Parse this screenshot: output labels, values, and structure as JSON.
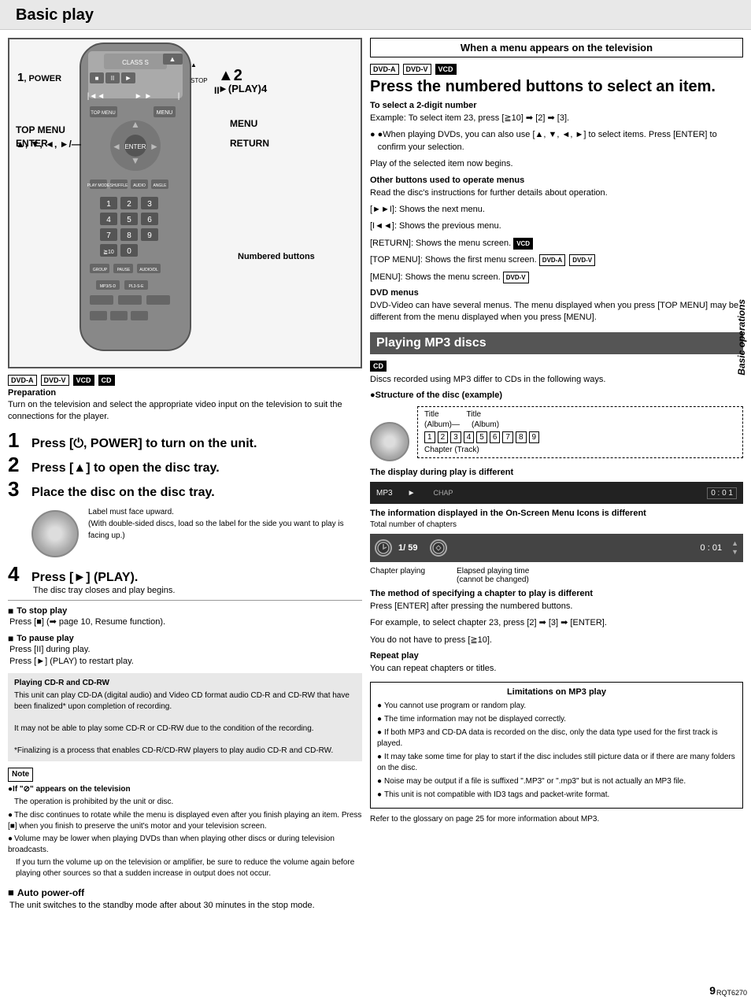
{
  "page": {
    "title": "Basic play",
    "page_number": "9",
    "rqt_code": "RQT6270",
    "side_label": "Basic operations"
  },
  "badges": {
    "dvd_a": "DVD-A",
    "dvd_v": "DVD-V",
    "vcd": "VCD",
    "cd": "CD"
  },
  "remote_labels": {
    "label1": "1",
    "power": ", POWER",
    "label2": "▲2",
    "play_4": "►(PLAY)4",
    "pause": "II",
    "arrows": "▲, ▼, ◄, ►/—",
    "top_menu": "TOP MENU",
    "menu": "MENU",
    "enter": "ENTER",
    "return": "RETURN",
    "numbered_buttons": "Numbered buttons"
  },
  "preparation": {
    "section_title": "Preparation",
    "text": "Turn on the television and select the appropriate video input on the television to suit the connections for the player."
  },
  "steps": {
    "step1_num": "1",
    "step1_text": "Press [⏻, POWER] to turn on the unit.",
    "step2_num": "2",
    "step2_text": "Press [▲] to open the disc tray.",
    "step3_num": "3",
    "step3_text": "Place the disc on the disc tray.",
    "disc_label1": "Label must face upward.",
    "disc_label2": "(With double-sided discs, load so the label for the side you want to play is facing up.)",
    "step4_num": "4",
    "step4_text": "Press [►] (PLAY).",
    "step4_sub": "The disc tray closes and play begins."
  },
  "to_stop": {
    "title": "To stop play",
    "text": "Press [■] (➡ page 10, Resume function)."
  },
  "to_pause": {
    "title": "To pause play",
    "line1": "Press [II] during play.",
    "line2": "Press [►] (PLAY) to restart play."
  },
  "info_box": {
    "title": "Playing CD-R and CD-RW",
    "text1": "This unit can play CD-DA (digital audio) and Video CD format audio CD-R and CD-RW that have been finalized* upon completion of recording.",
    "text2": "It may not be able to play some CD-R or CD-RW due to the condition of the recording.",
    "text3": "*Finalizing is a process that enables CD-R/CD-RW players to play audio CD-R and CD-RW."
  },
  "note": {
    "title": "Note",
    "item1_label": "●If \"⊘\" appears on the television",
    "item1_text": "The operation is prohibited by the unit or disc.",
    "item2": "The disc continues to rotate while the menu is displayed even after you finish playing an item. Press [■] when you finish to preserve the unit's motor and your television screen.",
    "item3": "Volume may be lower when playing DVDs than when playing other discs or during television broadcasts.",
    "item3b": "If you turn the volume up on the television or amplifier, be sure to reduce the volume again before playing other sources so that a sudden increase in output does not occur."
  },
  "auto_power": {
    "title": "Auto power-off",
    "text": "The unit switches to the standby mode after about 30 minutes in the stop mode."
  },
  "right": {
    "menu_banner": "When a menu appears on the television",
    "press_heading": "Press the numbered buttons to select an item.",
    "select_2digit_title": "To select a 2-digit number",
    "select_2digit_text1": "Example: To select item 23, press [≧10] ➡ [2] ➡ [3].",
    "select_2digit_text2": "●When playing DVDs, you can also use [▲, ▼, ◄, ►] to select items. Press [ENTER] to confirm your selection.",
    "select_2digit_text3": "Play of the selected item now begins.",
    "other_buttons_title": "Other buttons used to operate menus",
    "other_buttons_intro": "Read the disc's instructions for further details about operation.",
    "btn1": "[►►I]:  Shows the next menu.",
    "btn2": "[I◄◄]:  Shows the previous menu.",
    "btn3_text": "[RETURN]:  Shows the menu screen.",
    "btn3_badge": "VCD",
    "btn4_text": "[TOP MENU]:  Shows the first menu screen.",
    "btn4_badge1": "DVD-A",
    "btn4_badge2": "DVD-V",
    "btn5_text": "[MENU]:  Shows the menu screen.",
    "btn5_badge": "DVD-V",
    "dvd_menus_title": "DVD menus",
    "dvd_menus_text": "DVD-Video can have several menus. The menu displayed when you press [TOP MENU] may be different from the menu displayed when you press [MENU].",
    "mp3_banner": "Playing MP3 discs",
    "cd_badge": "CD",
    "mp3_intro": "Discs recorded using MP3 differ to CDs in the following ways.",
    "structure_title": "●Structure of the disc (example)",
    "tree_title1": "Title",
    "tree_title2": "Title",
    "tree_album1": "(Album)—",
    "tree_album2": "(Album)",
    "tree_nums": [
      "1",
      "2",
      "3",
      "4",
      "5",
      "6",
      "7",
      "8",
      "9"
    ],
    "tree_chapter": "Chapter (Track)",
    "display_title": "The display during play is different",
    "display_content": "MP3  ►",
    "display_chap": "CHAP",
    "on_screen_title": "The information displayed in the On-Screen Menu Icons is different",
    "total_chapters_label": "Total number of chapters",
    "chapter_playing_label": "Chapter playing",
    "elapsed_label": "Elapsed playing time",
    "cannot_label": "(cannot be changed)",
    "chapter_num": "1/ 59",
    "time_display": "0 : 01",
    "method_title": "The method of specifying a chapter to play is different",
    "method_text1": "Press [ENTER] after pressing the numbered buttons.",
    "method_text2": "For example, to select chapter 23, press [2] ➡ [3] ➡ [ENTER].",
    "method_text3": "You do not have to press [≧10].",
    "repeat_title": "Repeat play",
    "repeat_text": "You can repeat chapters or titles.",
    "limitations_title": "Limitations on MP3 play",
    "lim1": "You cannot use program or random play.",
    "lim2": "The time information may not be displayed correctly.",
    "lim3": "If both MP3 and CD-DA data is recorded on the disc, only the data type used for the first track is played.",
    "lim4": "It may take some time for play to start if the disc includes still picture data or if there are many folders on the disc.",
    "lim5": "Noise may be output if a file is suffixed \".MP3\" or \".mp3\" but is not actually an MP3 file.",
    "lim6": "This unit is not compatible with ID3 tags and packet-write format.",
    "glossary_text": "Refer to the glossary on page 25 for more information about MP3."
  }
}
